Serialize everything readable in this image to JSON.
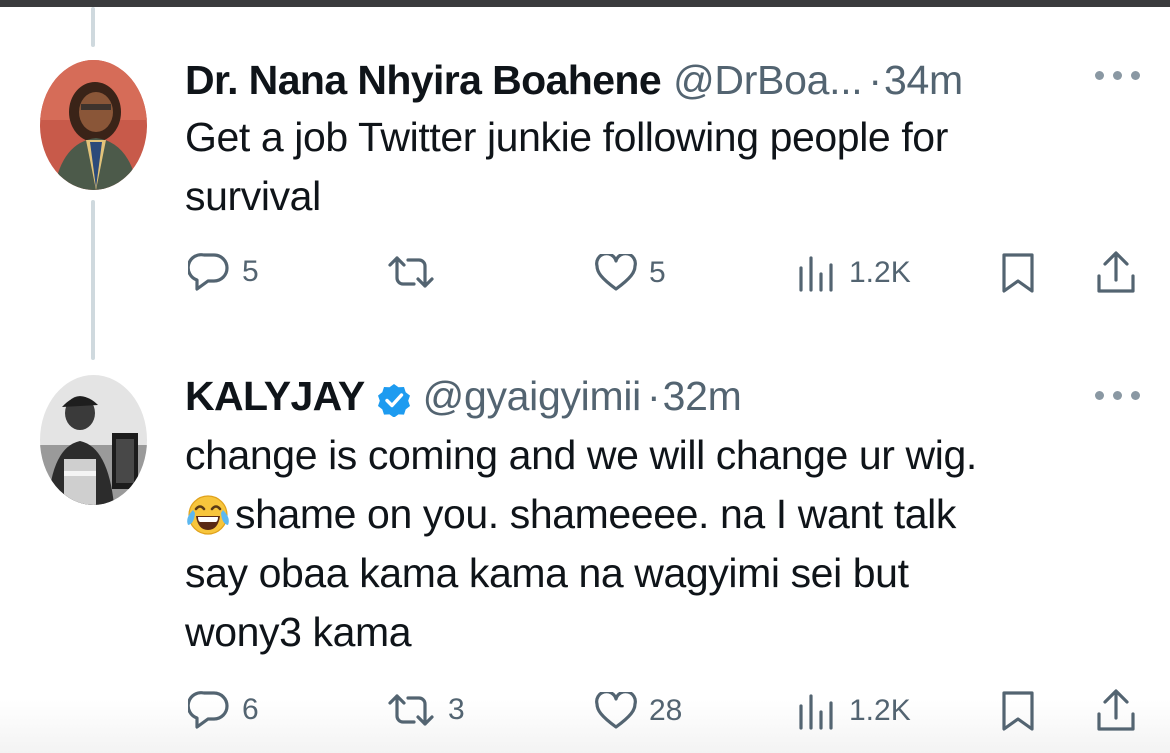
{
  "tweets": [
    {
      "name": "Dr. Nana Nhyira Boahene",
      "handle": "@DrBoa...",
      "separator": "·",
      "time": "34m",
      "verified": false,
      "text_lines": [
        "Get a job Twitter junkie following people for",
        "survival"
      ],
      "reply_count": "5",
      "retweet_count": "",
      "like_count": "5",
      "view_count": "1.2K"
    },
    {
      "name": "KALYJAY",
      "handle": "@gyaigyimii",
      "separator": "·",
      "time": "32m",
      "verified": true,
      "text_lines": [
        "change is coming and we will change ur wig.",
        "shame on you. shameeee. na I want talk",
        "say obaa kama kama na wagyimi sei but",
        "wony3 kama"
      ],
      "emoji": "face-with-tears-of-joy",
      "reply_count": "6",
      "retweet_count": "3",
      "like_count": "28",
      "view_count": "1.2K"
    }
  ],
  "icons": {
    "reply": "reply-icon",
    "retweet": "retweet-icon",
    "like": "like-icon",
    "views": "views-icon",
    "bookmark": "bookmark-icon",
    "share": "share-icon",
    "more": "more-icon",
    "verified": "verified-badge-icon"
  },
  "colors": {
    "text": "#0f1419",
    "secondary": "#536471",
    "verified": "#1d9bf0",
    "thread_line": "#cfd9de"
  }
}
